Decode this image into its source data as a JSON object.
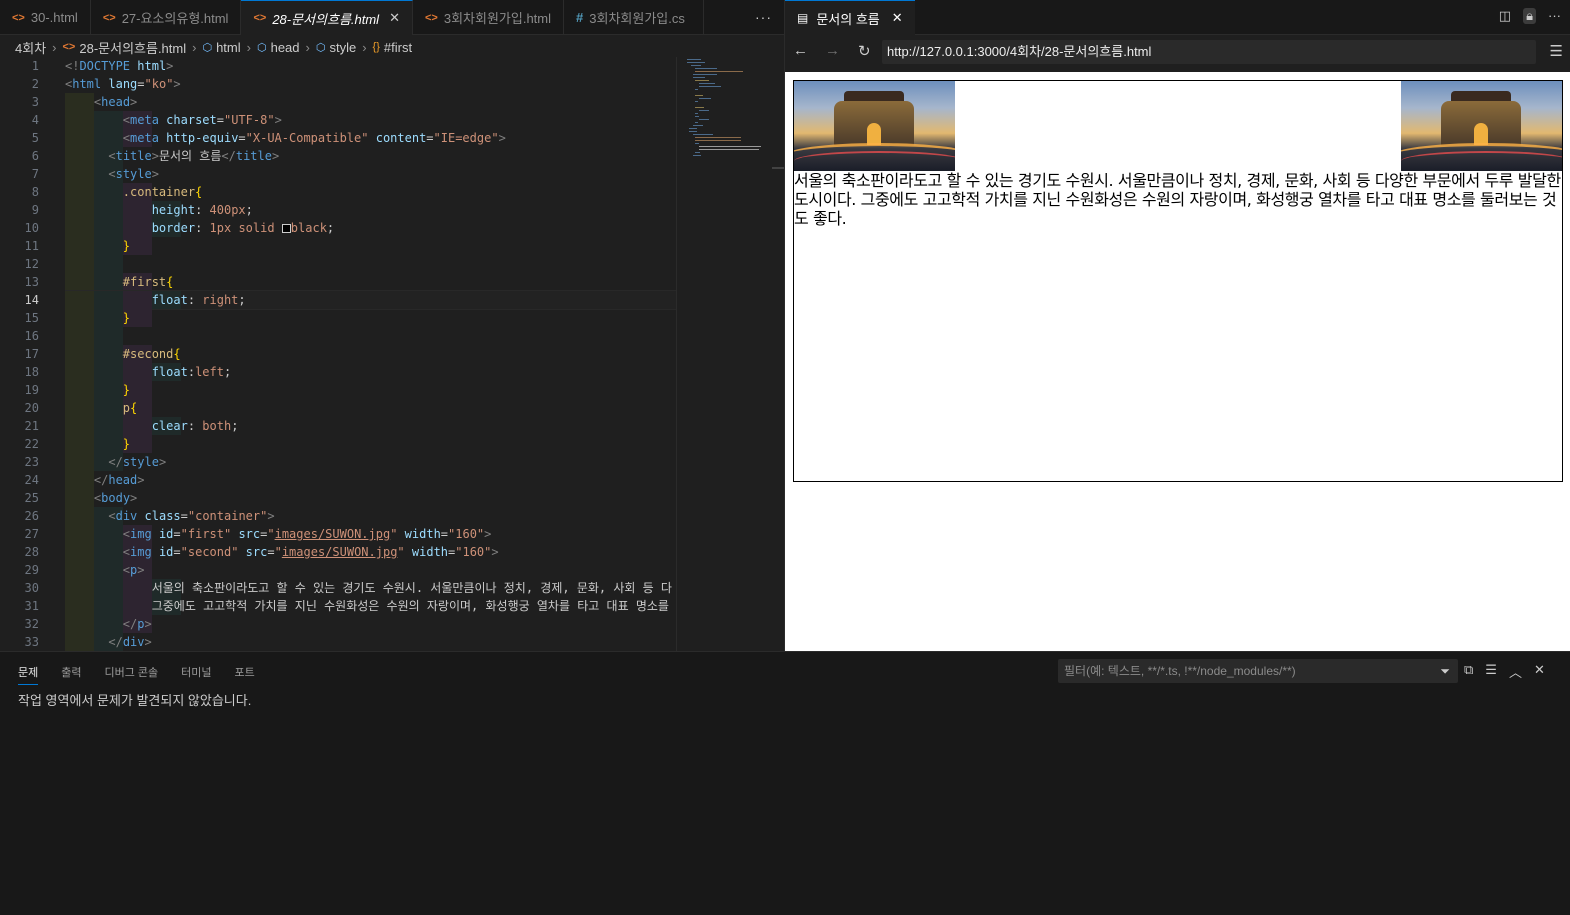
{
  "editor": {
    "tabs": [
      {
        "icon": "<>",
        "label": "30-.html",
        "active": false
      },
      {
        "icon": "<>",
        "label": "27-요소의유형.html",
        "active": false
      },
      {
        "icon": "<>",
        "label": "28-문서의흐름.html",
        "active": true
      },
      {
        "icon": "<>",
        "label": "3회차회원가입.html",
        "active": false
      },
      {
        "icon": "#",
        "label": "3회차회원가입.cs",
        "active": false
      }
    ],
    "more": "···",
    "breadcrumb": [
      "4회차",
      "28-문서의흐름.html",
      "html",
      "head",
      "style",
      "#first"
    ],
    "line_numbers": [
      "1",
      "2",
      "3",
      "4",
      "5",
      "6",
      "7",
      "8",
      "9",
      "10",
      "11",
      "12",
      "13",
      "14",
      "15",
      "16",
      "17",
      "18",
      "19",
      "20",
      "21",
      "22",
      "23",
      "24",
      "25",
      "26",
      "27",
      "28",
      "29",
      "30",
      "31",
      "32",
      "33"
    ],
    "current_line": "14"
  },
  "preview": {
    "tab_title": "문서의 흐름",
    "url": "http://127.0.0.1:3000/4회차/28-문서의흐름.html",
    "paragraph": "서울의 축소판이라도고 할 수 있는 경기도 수원시. 서울만큼이나 정치, 경제, 문화, 사회 등 다양한 부문에서 두루 발달한 도시이다. 그중에도 고고학적 가치를 지닌 수원화성은 수원의 자랑이며, 화성행궁 열차를 타고 대표 명소를 둘러보는 것도 좋다."
  },
  "panel": {
    "tabs": [
      "문제",
      "출력",
      "디버그 콘솔",
      "터미널",
      "포트"
    ],
    "active_tab": "문제",
    "filter_placeholder": "필터(예: 텍스트, **/*.ts, !**/node_modules/**)",
    "message": "작업 영역에서 문제가 발견되지 않았습니다."
  },
  "colors": {
    "accent": "#0078d4",
    "editor_bg": "#1f1f1f",
    "tag": "#569cd6",
    "string": "#ce9178",
    "attr": "#9cdcfe",
    "selector": "#d7ba7d"
  }
}
